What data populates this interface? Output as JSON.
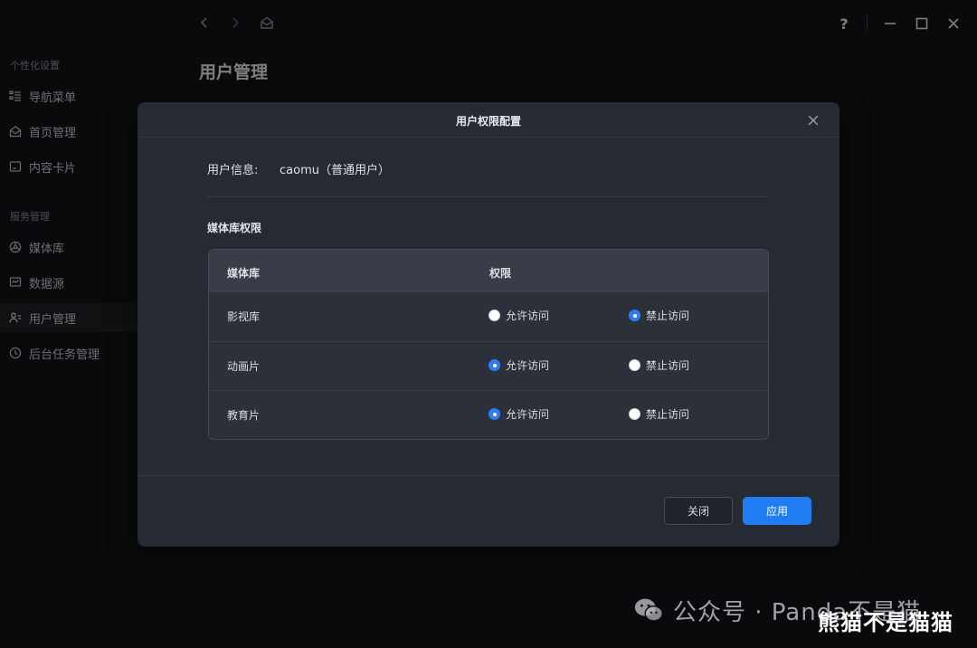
{
  "sidebar": {
    "sections": [
      {
        "title": "个性化设置"
      },
      {
        "title": "服务管理"
      }
    ],
    "items": [
      {
        "label": "导航菜单",
        "icon": "list-icon"
      },
      {
        "label": "首页管理",
        "icon": "home-icon"
      },
      {
        "label": "内容卡片",
        "icon": "card-icon"
      },
      {
        "label": "媒体库",
        "icon": "media-library-icon"
      },
      {
        "label": "数据源",
        "icon": "data-source-icon"
      },
      {
        "label": "用户管理",
        "icon": "user-manage-icon",
        "active": true
      },
      {
        "label": "后台任务管理",
        "icon": "clock-icon"
      }
    ]
  },
  "header": {
    "page_title": "用户管理",
    "help": "?"
  },
  "modal": {
    "title": "用户权限配置",
    "user_info_label": "用户信息:",
    "user_info_value": "caomu（普通用户）",
    "section_title": "媒体库权限",
    "table": {
      "columns": [
        "媒体库",
        "权限"
      ],
      "rows": [
        {
          "name": "影视库",
          "allow": "允许访问",
          "deny": "禁止访问",
          "selected": "deny"
        },
        {
          "name": "动画片",
          "allow": "允许访问",
          "deny": "禁止访问",
          "selected": "allow"
        },
        {
          "name": "教育片",
          "allow": "允许访问",
          "deny": "禁止访问",
          "selected": "allow"
        }
      ]
    },
    "buttons": {
      "close": "关闭",
      "apply": "应用"
    }
  },
  "watermark": {
    "account": "公众号 · Panda不是猫",
    "title": "熊猫不是猫猫"
  },
  "colors": {
    "accent": "#1f7cf2",
    "modal_bg": "#262a33",
    "background": "#121316"
  }
}
